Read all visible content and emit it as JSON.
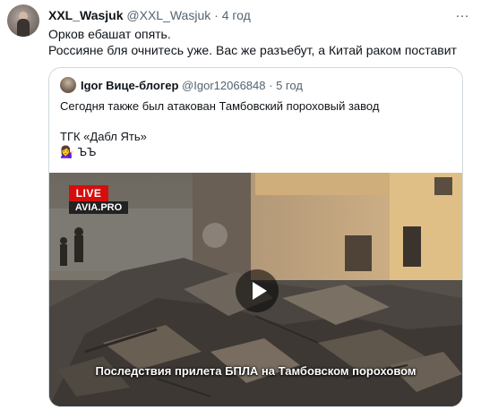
{
  "tweet": {
    "author_name": "XXL_Wasjuk",
    "author_handle": "@XXL_Wasjuk",
    "separator": "·",
    "time": "4 год",
    "more_icon": "…",
    "lines": [
      "Орков ебашат опять.",
      "Россияне бля очнитесь уже. Вас же разъебут, а Китай раком поставит"
    ]
  },
  "quote": {
    "author_name": "Igor Вице-блогер",
    "author_handle": "@Igor12066848",
    "separator": "·",
    "time": "5 год",
    "line1": "Сегодня также был атакован Тамбовский пороховый завод",
    "line2": "ТГК «Дабл Ять»",
    "emoji_line": "💁‍♀️ ЪЪ"
  },
  "media": {
    "live_badge": "LIVE",
    "source_label": "AVIA.PRO",
    "caption": "Последствия прилета БПЛА на Тамбовском пороховом",
    "icons": {
      "play": "play-icon"
    }
  }
}
